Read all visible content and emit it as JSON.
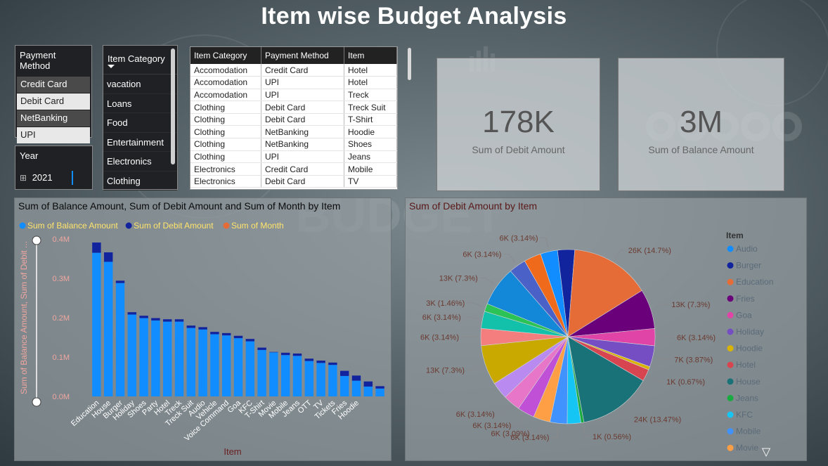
{
  "title": "Item wise Budget Analysis",
  "payment_slicer": {
    "header": "Payment Method",
    "items": [
      {
        "label": "Credit Card",
        "selected": true
      },
      {
        "label": "Debit Card",
        "selected": false
      },
      {
        "label": "NetBanking",
        "selected": true
      },
      {
        "label": "UPI",
        "selected": false
      }
    ]
  },
  "year_slicer": {
    "header": "Year",
    "expand_glyph": "⊞",
    "value": "2021"
  },
  "category_slicer": {
    "header": "Item Category",
    "items": [
      "vacation",
      "Loans",
      "Food",
      "Entertainment",
      "Electronics",
      "Clothing"
    ]
  },
  "table": {
    "columns": [
      "Item Category",
      "Payment Method",
      "Item"
    ],
    "rows": [
      [
        "Accomodation",
        "Credit Card",
        "Hotel"
      ],
      [
        "Accomodation",
        "UPI",
        "Hotel"
      ],
      [
        "Accomodation",
        "UPI",
        "Treck"
      ],
      [
        "Clothing",
        "Debit Card",
        "Treck Suit"
      ],
      [
        "Clothing",
        "Debit Card",
        "T-Shirt"
      ],
      [
        "Clothing",
        "NetBanking",
        "Hoodie"
      ],
      [
        "Clothing",
        "NetBanking",
        "Shoes"
      ],
      [
        "Clothing",
        "UPI",
        "Jeans"
      ],
      [
        "Electronics",
        "Credit Card",
        "Mobile"
      ],
      [
        "Electronics",
        "Debit Card",
        "TV"
      ]
    ]
  },
  "cards": [
    {
      "value": "178K",
      "label": "Sum of Debit Amount"
    },
    {
      "value": "3M",
      "label": "Sum of Balance Amount"
    }
  ],
  "colors": {
    "balance": "#118dff",
    "debit": "#12239e",
    "month": "#e66c37",
    "panel_title": "#0b0b0b",
    "axis_title": "#f0a6a0",
    "pie_label": "#6b3a30",
    "slicer_bg": "#1f2124"
  },
  "chart_data": [
    {
      "type": "bar",
      "title": "Sum of Balance Amount, Sum of Debit Amount and Sum of Month by Item",
      "xlabel": "Item",
      "ylabel": "Sum of Balance Amount, Sum of Debit ...",
      "yticks": [
        "0.0M",
        "0.1M",
        "0.2M",
        "0.3M",
        "0.4M"
      ],
      "ylim": [
        0,
        0.4
      ],
      "legend": "top-left",
      "series": [
        {
          "name": "Sum of Balance Amount",
          "color": "#118dff",
          "values": [
            0.365,
            0.342,
            0.288,
            0.208,
            0.199,
            0.193,
            0.19,
            0.19,
            0.174,
            0.17,
            0.158,
            0.155,
            0.148,
            0.14,
            0.118,
            0.112,
            0.105,
            0.103,
            0.09,
            0.085,
            0.08,
            0.052,
            0.04,
            0.025,
            0.02
          ]
        },
        {
          "name": "Sum of Debit Amount",
          "color": "#12239e",
          "values": [
            0.026,
            0.024,
            0.006,
            0.006,
            0.006,
            0.006,
            0.006,
            0.006,
            0.006,
            0.006,
            0.006,
            0.006,
            0.006,
            0.006,
            0.006,
            0.001,
            0.006,
            0.006,
            0.006,
            0.006,
            0.006,
            0.013,
            0.013,
            0.013,
            0.006
          ]
        },
        {
          "name": "Sum of Month",
          "color": "#e66c37",
          "values": [
            0,
            0,
            0,
            0,
            0,
            0,
            0,
            0,
            0,
            0,
            0,
            0,
            0,
            0,
            0,
            0,
            0,
            0,
            0,
            0,
            0,
            0,
            0,
            0,
            0
          ]
        }
      ],
      "categories": [
        "Education",
        "House",
        "Burger",
        "Holiday",
        "Shoes",
        "Party",
        "Hotel",
        "Treck",
        "Treck Suit",
        "Audio",
        "Vehicle",
        "Voice Command",
        "Goa",
        "KFC",
        "T-Shirt",
        "Movie",
        "Mobile",
        "Jeans",
        "OTT",
        "TV",
        "Tickets",
        "Fries",
        "Hoodie",
        "",
        ""
      ]
    },
    {
      "type": "pie",
      "title": "Sum of Debit Amount by Item",
      "legend_title": "Item",
      "legend": "right",
      "slices": [
        {
          "label": "6K (3.14%)",
          "value": 3.14,
          "color": "#118dff"
        },
        {
          "label": "",
          "value": 3.14,
          "color": "#12239e"
        },
        {
          "label": "26K (14.7%)",
          "value": 14.7,
          "color": "#e66c37"
        },
        {
          "label": "13K (7.3%)",
          "value": 7.3,
          "color": "#6b007b"
        },
        {
          "label": "6K (3.14%)",
          "value": 3.14,
          "color": "#e044a7"
        },
        {
          "label": "7K (3.87%)",
          "value": 3.87,
          "color": "#744ec2"
        },
        {
          "label": "",
          "value": 0.6,
          "color": "#d9b300"
        },
        {
          "label": "1K (0.67%)",
          "value": 2.2,
          "color": "#d64550"
        },
        {
          "label": "24K (13.47%)",
          "value": 13.47,
          "color": "#197278"
        },
        {
          "label": "1K (0.56%)",
          "value": 0.56,
          "color": "#1aab40"
        },
        {
          "label": "",
          "value": 2.5,
          "color": "#15c6f4"
        },
        {
          "label": "6K (3.14%)",
          "value": 3.14,
          "color": "#4092ff"
        },
        {
          "label": "6K (3.09%)",
          "value": 3.09,
          "color": "#ff9f45"
        },
        {
          "label": "6K (3.14%)",
          "value": 3.14,
          "color": "#c050d6"
        },
        {
          "label": "6K (3.14%)",
          "value": 3.14,
          "color": "#e776c8"
        },
        {
          "label": "",
          "value": 3.14,
          "color": "#b98af0"
        },
        {
          "label": "13K (7.3%)",
          "value": 7.3,
          "color": "#c9a800"
        },
        {
          "label": "6K (3.14%)",
          "value": 3.14,
          "color": "#f47e7e"
        },
        {
          "label": "6K (3.14%)",
          "value": 3.14,
          "color": "#13c1ab"
        },
        {
          "label": "3K (1.46%)",
          "value": 1.46,
          "color": "#2bc256"
        },
        {
          "label": "13K (7.3%)",
          "value": 7.3,
          "color": "#1488d8"
        },
        {
          "label": "6K (3.14%)",
          "value": 3.14,
          "color": "#4a62c8"
        },
        {
          "label": "",
          "value": 3.14,
          "color": "#f06a1b"
        }
      ],
      "legend_items": [
        {
          "label": "Audio",
          "color": "#118dff"
        },
        {
          "label": "Burger",
          "color": "#12239e"
        },
        {
          "label": "Education",
          "color": "#e66c37"
        },
        {
          "label": "Fries",
          "color": "#6b007b"
        },
        {
          "label": "Goa",
          "color": "#e044a7"
        },
        {
          "label": "Holiday",
          "color": "#744ec2"
        },
        {
          "label": "Hoodie",
          "color": "#d9b300"
        },
        {
          "label": "Hotel",
          "color": "#d64550"
        },
        {
          "label": "House",
          "color": "#197278"
        },
        {
          "label": "Jeans",
          "color": "#1aab40"
        },
        {
          "label": "KFC",
          "color": "#15c6f4"
        },
        {
          "label": "Mobile",
          "color": "#4092ff"
        },
        {
          "label": "Movie",
          "color": "#ff9f45"
        }
      ],
      "legend_more_glyph": "▽"
    }
  ]
}
